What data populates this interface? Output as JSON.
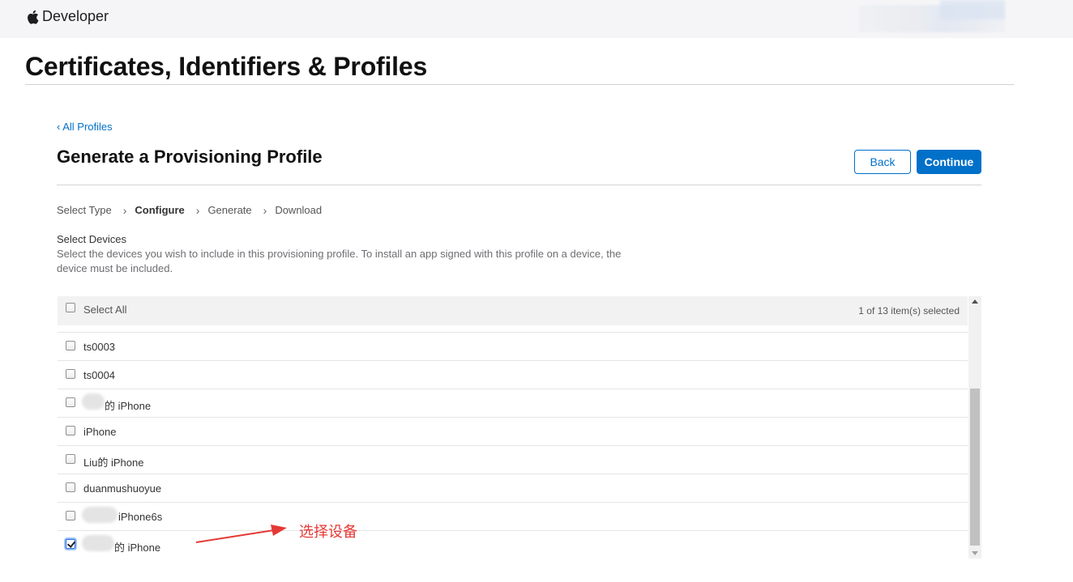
{
  "nav": {
    "brand": "Developer"
  },
  "page": {
    "title": "Certificates, Identifiers & Profiles"
  },
  "breadcrumb": {
    "back": "‹ All Profiles"
  },
  "section": {
    "title": "Generate a Provisioning Profile"
  },
  "buttons": {
    "back": "Back",
    "continue": "Continue"
  },
  "steps": [
    "Select Type",
    "Configure",
    "Generate",
    "Download"
  ],
  "devices": {
    "heading": "Select Devices",
    "description": "Select the devices you wish to include in this provisioning profile. To install an app signed with this profile on a device, the device must be included.",
    "select_all": "Select All",
    "count": "1 of 13 item(s) selected",
    "items": [
      {
        "name": "ts0003",
        "checked": false
      },
      {
        "name": "ts0004",
        "checked": false
      },
      {
        "name": "的 iPhone",
        "checked": false
      },
      {
        "name": "iPhone",
        "checked": false
      },
      {
        "name": "Liu的 iPhone",
        "checked": false
      },
      {
        "name": "duanmushuoyue",
        "checked": false
      },
      {
        "name": "iPhone6s",
        "checked": false
      },
      {
        "name": "的 iPhone",
        "checked": true
      }
    ]
  },
  "annotation": {
    "text": "选择设备",
    "color": "#e53935"
  },
  "colors": {
    "accent": "#0070c9"
  }
}
